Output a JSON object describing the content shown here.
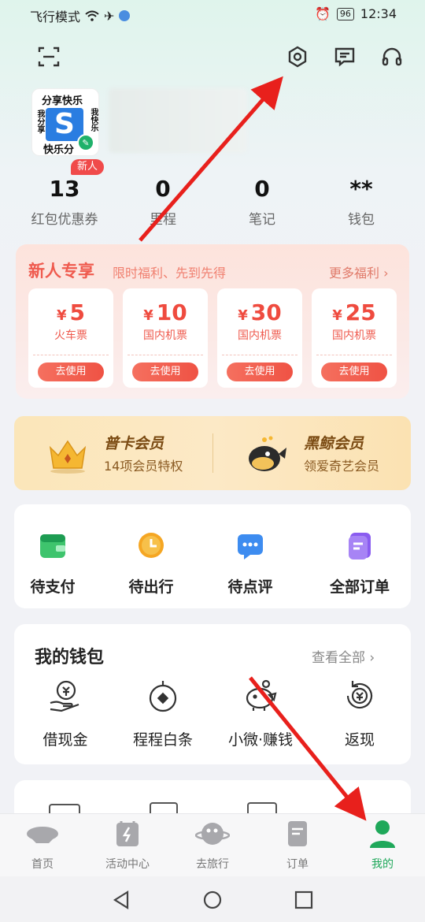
{
  "status_bar": {
    "left_text": "飞行模式",
    "battery": "96",
    "time": "12:34"
  },
  "header": {
    "icons": [
      "scan-icon",
      "settings-icon",
      "message-icon",
      "customer-service-icon"
    ]
  },
  "profile": {
    "avatar_text_top": "分享快乐",
    "avatar_text_left": "我分享",
    "avatar_text_right": "我快乐",
    "avatar_text_bottom": "快乐分",
    "avatar_logo": "S",
    "new_badge": "新人"
  },
  "stats": [
    {
      "value": "13",
      "label": "红包优惠券"
    },
    {
      "value": "0",
      "label": "里程"
    },
    {
      "value": "0",
      "label": "笔记"
    },
    {
      "value": "**",
      "label": "钱包"
    }
  ],
  "newcomer": {
    "title": "新人专享",
    "subtitle": "限时福利、先到先得",
    "more": "更多福利 ›",
    "coupons": [
      {
        "currency": "¥",
        "amount": "5",
        "name": "火车票",
        "button": "去使用"
      },
      {
        "currency": "¥",
        "amount": "10",
        "name": "国内机票",
        "button": "去使用"
      },
      {
        "currency": "¥",
        "amount": "30",
        "name": "国内机票",
        "button": "去使用"
      },
      {
        "currency": "¥",
        "amount": "25",
        "name": "国内机票",
        "button": "去使用"
      }
    ]
  },
  "membership": [
    {
      "title": "普卡会员",
      "subtitle": "14项会员特权"
    },
    {
      "title": "黑鲸会员",
      "subtitle": "领爱奇艺会员"
    }
  ],
  "orders": [
    {
      "label": "待支付",
      "icon": "wallet-icon"
    },
    {
      "label": "待出行",
      "icon": "clock-icon"
    },
    {
      "label": "待点评",
      "icon": "comment-icon"
    },
    {
      "label": "全部订单",
      "icon": "orders-icon"
    }
  ],
  "wallet": {
    "title": "我的钱包",
    "more": "查看全部 ›",
    "items": [
      {
        "label": "借现金",
        "icon": "cash-loan-icon"
      },
      {
        "label": "程程白条",
        "icon": "credit-icon"
      },
      {
        "label": "小微·赚钱",
        "icon": "piggy-bank-icon"
      },
      {
        "label": "返现",
        "icon": "cashback-icon"
      }
    ]
  },
  "bottom_nav": [
    {
      "label": "首页",
      "icon": "home-icon",
      "active": false
    },
    {
      "label": "活动中心",
      "icon": "activity-icon",
      "active": false
    },
    {
      "label": "去旅行",
      "icon": "travel-icon",
      "active": false
    },
    {
      "label": "订单",
      "icon": "order-icon",
      "active": false
    },
    {
      "label": "我的",
      "icon": "profile-icon",
      "active": true
    }
  ],
  "colors": {
    "accent_green": "#1fa85a",
    "coupon_red": "#ef4b3f",
    "annotation_red": "#e8201c"
  }
}
